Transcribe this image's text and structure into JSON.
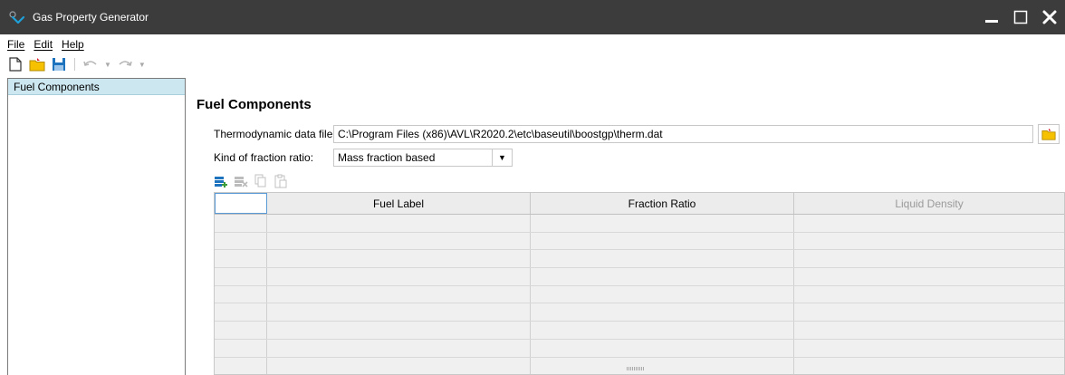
{
  "window": {
    "title": "Gas Property Generator",
    "controls": [
      "minimize-icon",
      "maximize-icon",
      "close-icon"
    ]
  },
  "menu": [
    {
      "label": "File"
    },
    {
      "label": "Edit"
    },
    {
      "label": "Help"
    }
  ],
  "toolbar": {
    "icons": [
      "new-file-icon",
      "open-folder-icon",
      "save-icon",
      "undo-icon",
      "redo-icon"
    ]
  },
  "sidebar": {
    "items": [
      {
        "label": "Fuel Components",
        "selected": true
      }
    ]
  },
  "main": {
    "title": "Fuel Components",
    "thermo_label": "Thermodynamic data file:",
    "thermo_value": "C:\\Program Files (x86)\\AVL\\R2020.2\\etc\\baseutil\\boostgp\\therm.dat",
    "fraction_label": "Kind of fraction ratio:",
    "fraction_value": "Mass fraction based",
    "grid_toolbar": [
      "add-row-icon",
      "delete-row-icon",
      "copy-icon",
      "paste-icon"
    ],
    "grid": {
      "columns": [
        "",
        "Fuel Label",
        "Fraction Ratio",
        "Liquid Density"
      ],
      "disabled_columns": [
        "Liquid Density"
      ],
      "empty_rows": 9
    }
  },
  "colors": {
    "titlebar_bg": "#3c3c3c",
    "selection_bg": "#cde7f0",
    "grid_bg": "#f0f0f0",
    "accent_yellow": "#f6c100",
    "accent_blue": "#1e73be",
    "accent_green": "#3a9b3a"
  }
}
